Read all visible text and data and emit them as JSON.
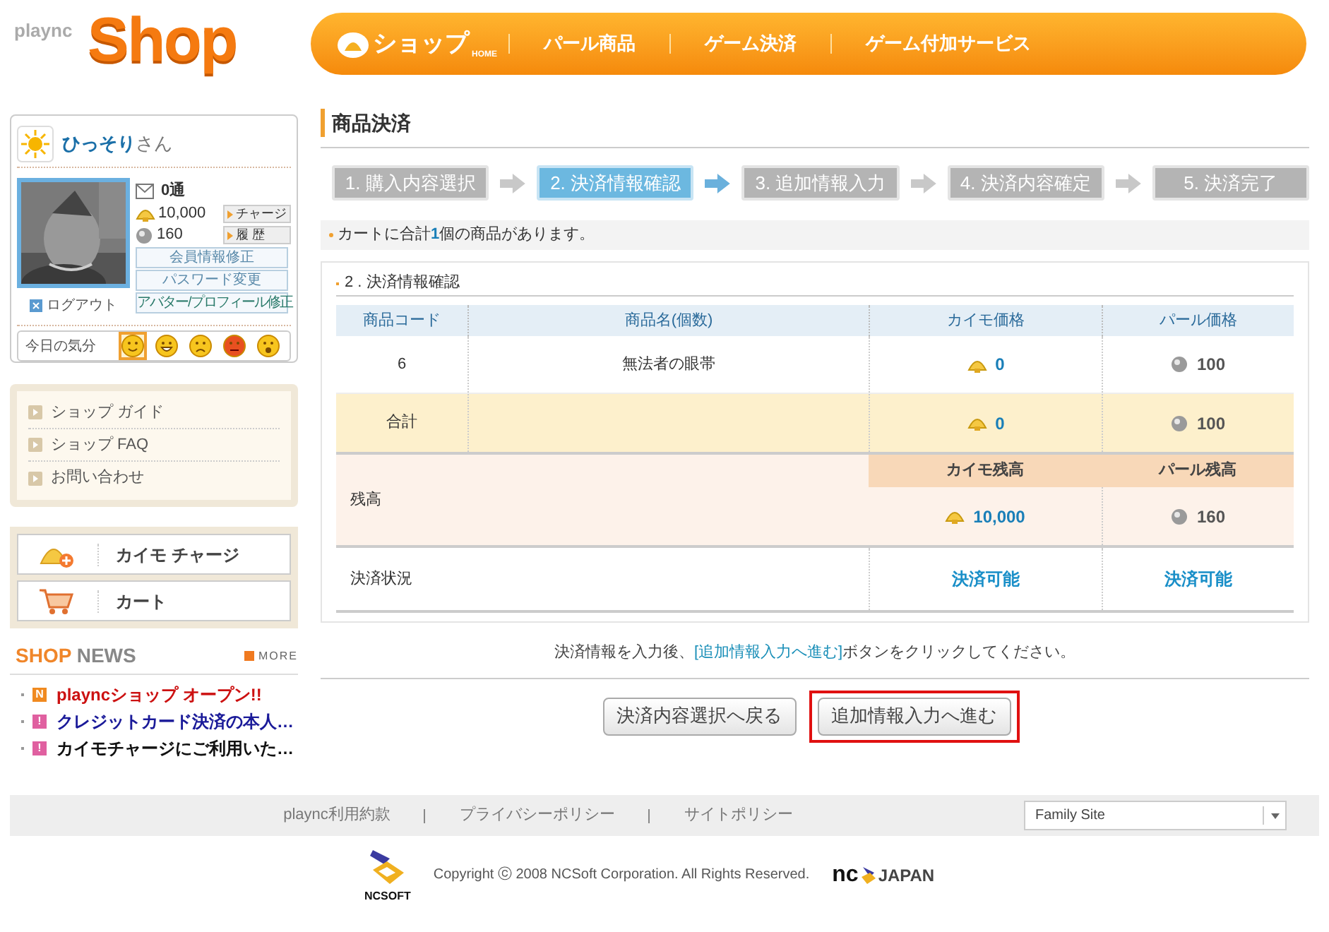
{
  "logo": {
    "brand": "plaync",
    "word": "Shop"
  },
  "nav": [
    {
      "label": "ショップ",
      "sub": "HOME",
      "kind": "home"
    },
    {
      "label": "パール商品",
      "kind": "link"
    },
    {
      "label": "ゲーム決済",
      "kind": "link"
    },
    {
      "label": "ゲーム付加サービス",
      "kind": "link"
    }
  ],
  "user": {
    "name": "ひっそり",
    "suffix": "さん",
    "mail": "0通",
    "kaimo": "10,000",
    "charge_button": "チャージ",
    "pearl": "160",
    "history_button": "履 歴",
    "buttons": [
      "会員情報修正",
      "パスワード変更",
      "アバター/プロフィール修正"
    ],
    "logout": "ログアウト",
    "mood_label": "今日の気分",
    "moods": [
      {
        "kind": "smile",
        "selected": true
      },
      {
        "kind": "grin",
        "selected": false
      },
      {
        "kind": "sad",
        "selected": false
      },
      {
        "kind": "angry",
        "selected": false
      },
      {
        "kind": "surprised",
        "selected": false
      }
    ]
  },
  "help_links": [
    "ショップ ガイド",
    "ショップ FAQ",
    "お問い合わせ"
  ],
  "quick_buttons": [
    {
      "label": "カイモ チャージ",
      "kind": "charge"
    },
    {
      "label": "カート",
      "kind": "cart"
    }
  ],
  "news": {
    "title_1": "SHOP",
    "title_2": "NEWS",
    "more": "MORE",
    "items": [
      {
        "badge": "N",
        "text": "playncショップ オープン!!",
        "color": "#cc1111"
      },
      {
        "badge": "!",
        "text": "クレジットカード決済の本人…",
        "color": "#1a1a99"
      },
      {
        "badge": "!",
        "text": "カイモチャージにご利用いた…",
        "color": "#111111"
      }
    ]
  },
  "page_title": "商品決済",
  "steps": [
    {
      "label": "1. 購入内容選択",
      "selected": false
    },
    {
      "label": "2. 決済情報確認",
      "selected": true
    },
    {
      "label": "3. 追加情報入力",
      "selected": false
    },
    {
      "label": "4. 決済内容確定",
      "selected": false
    },
    {
      "label": "5. 決済完了",
      "selected": false
    }
  ],
  "cart_notice": "カートに合計**1**個の商品があります。",
  "section_title": "2 . 決済情報確認",
  "table": {
    "columns": [
      "商品コード",
      "商品名(個数)",
      "カイモ価格",
      "パール価格"
    ],
    "rows": [
      {
        "code": "6",
        "name": "無法者の眼帯",
        "kaimo": "0",
        "pearl": "100"
      }
    ],
    "total": {
      "label": "合計",
      "kaimo": "0",
      "pearl": "100"
    },
    "balance": {
      "label": "残高",
      "kaimo_heading": "カイモ残高",
      "pearl_heading": "パール残高",
      "kaimo": "10,000",
      "pearl": "160"
    },
    "status": {
      "label": "決済状況",
      "kaimo": "決済可能",
      "pearl": "決済可能"
    }
  },
  "instruction": {
    "before": "決済情報を入力後、",
    "link": "[追加情報入力へ進む]",
    "after": "ボタンをクリックしてください。"
  },
  "buttons": [
    {
      "label": "決済内容選択へ戻る",
      "highlighted": false
    },
    {
      "label": "追加情報入力へ進む",
      "highlighted": true
    }
  ],
  "footer": {
    "links": [
      "plaync利用約款",
      "プライバシーポリシー",
      "サイトポリシー"
    ],
    "family_site": "Family Site",
    "copyright": "Copyright ⓒ 2008 NCSoft Corporation. All Rights Reserved.",
    "ncsoft": "NCSOFT",
    "nc": "nc",
    "japan": "JAPAN"
  }
}
